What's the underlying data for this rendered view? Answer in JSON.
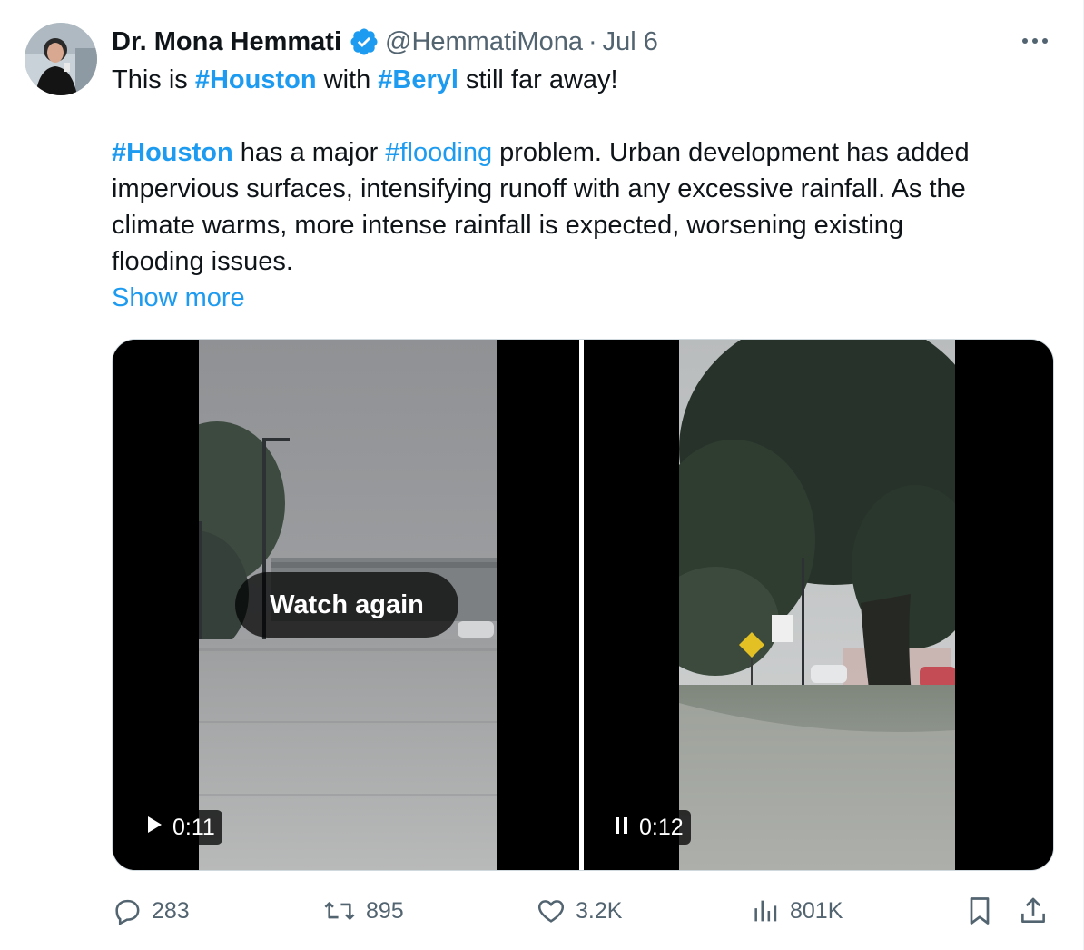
{
  "author": {
    "name": "Dr. Mona Hemmati",
    "handle": "@HemmatiMona",
    "separator": "·",
    "date": "Jul 6"
  },
  "tweet": {
    "line1": {
      "t1": "This is ",
      "tag1": "#Houston",
      "t2": " with ",
      "tag2": "#Beryl",
      "t3": " still far away!"
    },
    "line2": {
      "tag1": "#Houston",
      "t1": " has a major ",
      "tag2": "#flooding",
      "t2": " problem. Urban development has added"
    },
    "line3": "impervious surfaces, intensifying runoff with any excessive rainfall. As the",
    "line4": "climate warms, more intense rainfall is expected, worsening existing",
    "line5": "flooding issues.",
    "show_more": "Show more"
  },
  "media": {
    "video1": {
      "overlay": "Watch again",
      "time": "0:11",
      "state_icon": "play-icon"
    },
    "video2": {
      "time": "0:12",
      "state_icon": "pause-icon"
    }
  },
  "actions": {
    "replies": "283",
    "reposts": "895",
    "likes": "3.2K",
    "views": "801K"
  },
  "colors": {
    "accent": "#1d9bf0",
    "muted": "#536471",
    "text": "#0f1419",
    "border": "#cfd9de"
  }
}
